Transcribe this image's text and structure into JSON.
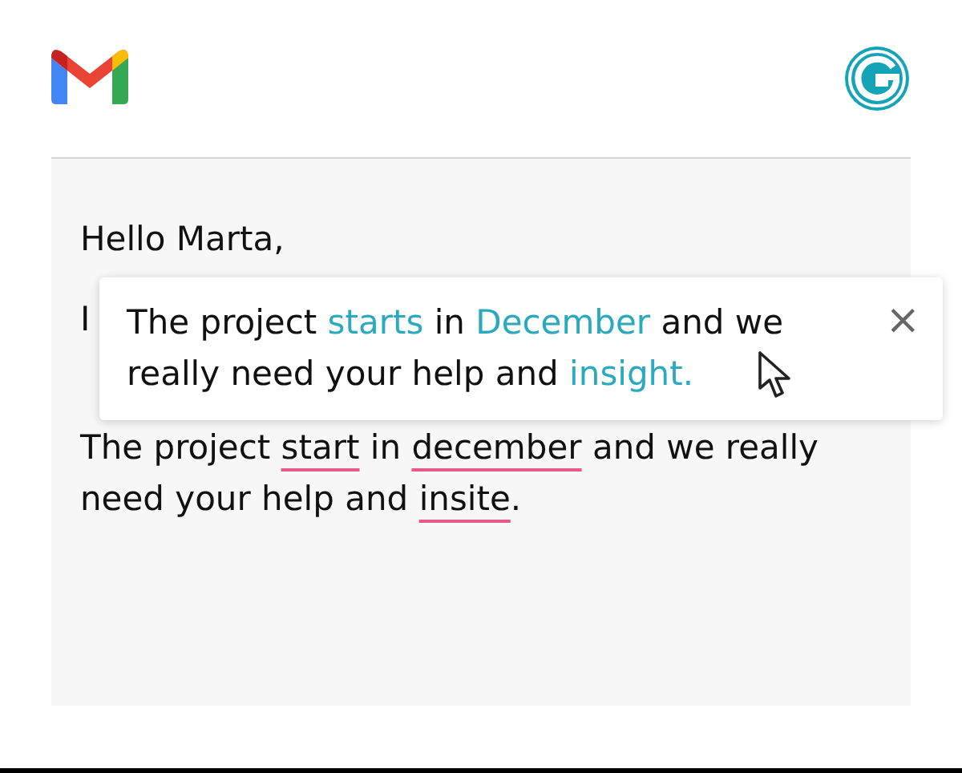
{
  "greeting": "Hello Marta,",
  "hidden_line": "I",
  "paragraph": [
    {
      "kind": "plain",
      "text": "The project "
    },
    {
      "kind": "error",
      "text": "start"
    },
    {
      "kind": "plain",
      "text": " in "
    },
    {
      "kind": "error",
      "text": "december"
    },
    {
      "kind": "plain",
      "text": " and we really need your help and "
    },
    {
      "kind": "error",
      "text": "insite"
    },
    {
      "kind": "plain",
      "text": "."
    }
  ],
  "suggestion": {
    "segments": [
      {
        "kind": "plain",
        "text": "The project "
      },
      {
        "kind": "fix",
        "text": "starts"
      },
      {
        "kind": "plain",
        "text": " in "
      },
      {
        "kind": "fix",
        "text": "December"
      },
      {
        "kind": "plain",
        "text": " and we really need your help and "
      },
      {
        "kind": "fix",
        "text": "insight."
      }
    ],
    "close": "×"
  }
}
